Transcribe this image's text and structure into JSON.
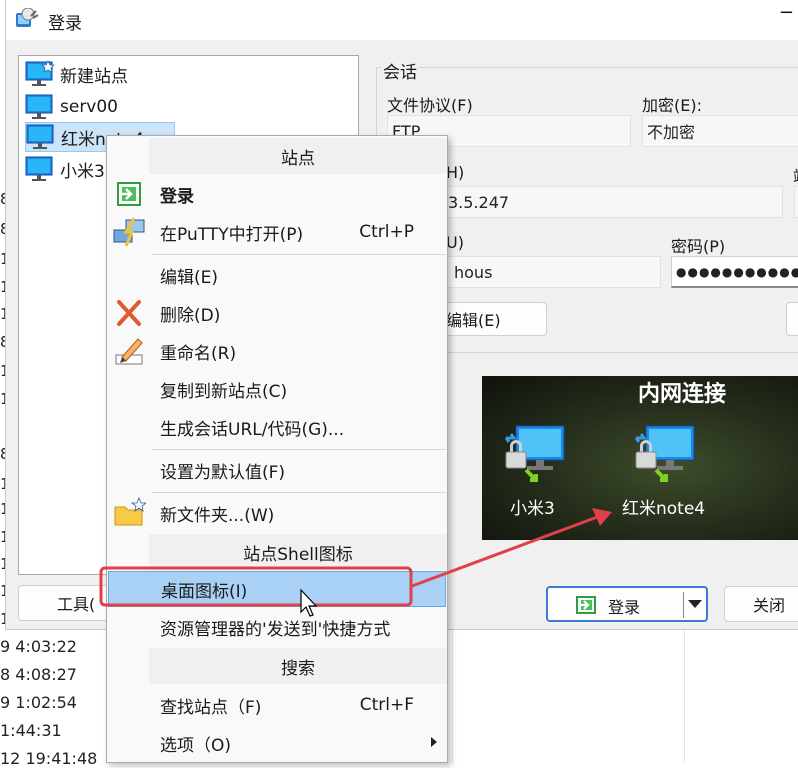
{
  "window": {
    "title": "登录",
    "minimize_glyph": "−"
  },
  "background": {
    "fragments": [
      "8",
      "8",
      "1",
      "1",
      "1",
      "8",
      "1",
      "1",
      "8",
      "1",
      "1",
      "1",
      "1",
      "1",
      "1"
    ],
    "dates": [
      "9 4:03:22",
      "8 4:08:27",
      "9 1:02:54",
      "1:44:31",
      "12 19:41:48"
    ]
  },
  "site_tree": {
    "items": [
      {
        "label": "新建站点",
        "icon": "new-site-monitor-icon"
      },
      {
        "label": "serv00",
        "icon": "monitor-icon"
      },
      {
        "label": "红米note4",
        "icon": "monitor-icon",
        "selected": true
      },
      {
        "label": "小米3",
        "icon": "monitor-icon"
      }
    ]
  },
  "session": {
    "legend": "会话",
    "protocol_label": "文件协议(F)",
    "protocol_value": "FTP",
    "encryption_label": "加密(E):",
    "encryption_value": "不加密",
    "host_label_partial": "H)",
    "host_value_partial": "3.5.247",
    "port_label_partial": "端",
    "user_label_partial": "U)",
    "user_value_partial": "hous",
    "password_label": "密码(P)",
    "password_value": "●●●●●●●●●●●●●",
    "edit_button_partial": "编辑(E)"
  },
  "banner": {
    "title": "内网连接",
    "icons": [
      {
        "label": "小米3"
      },
      {
        "label": "红米note4"
      }
    ]
  },
  "buttons": {
    "tools_partial": "工具(",
    "login": "登录",
    "close": "关闭"
  },
  "context_menu": {
    "headers": {
      "site": "站点",
      "shell": "站点Shell图标",
      "search": "搜索"
    },
    "items": {
      "login": {
        "label": "登录"
      },
      "putty": {
        "label": "在PuTTY中打开(P)",
        "shortcut": "Ctrl+P"
      },
      "edit": {
        "label": "编辑(E)"
      },
      "delete": {
        "label": "删除(D)"
      },
      "rename": {
        "label": "重命名(R)"
      },
      "copy": {
        "label": "复制到新站点(C)"
      },
      "url": {
        "label": "生成会话URL/代码(G)..."
      },
      "default": {
        "label": "设置为默认值(F)"
      },
      "new_folder": {
        "label": "新文件夹...(W)"
      },
      "desktop_icon": {
        "label": "桌面图标(I)"
      },
      "sendto": {
        "label": "资源管理器的'发送到'快捷方式"
      },
      "find": {
        "label": "查找站点（F)",
        "shortcut": "Ctrl+F"
      },
      "options": {
        "label": "选项（O)"
      }
    }
  },
  "colors": {
    "accent": "#3c78d8",
    "highlight": "#a8d1f5",
    "annotation": "#e0404a"
  }
}
